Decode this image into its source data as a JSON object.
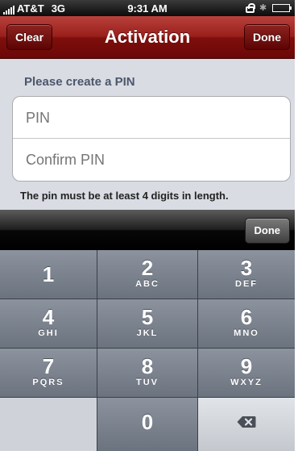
{
  "status_bar": {
    "carrier": "AT&T",
    "network": "3G",
    "time": "9:31 AM",
    "icons": [
      "signal-bars-icon",
      "lock-icon",
      "bluetooth-icon",
      "battery-icon"
    ]
  },
  "nav": {
    "title": "Activation",
    "left_button": "Clear",
    "right_button": "Done"
  },
  "form": {
    "section_header": "Please create a PIN",
    "pin_placeholder": "PIN",
    "confirm_placeholder": "Confirm PIN",
    "hint": "The pin must be at least 4 digits in length."
  },
  "accessory": {
    "done_label": "Done"
  },
  "keypad": {
    "keys": [
      {
        "digit": "1",
        "letters": ""
      },
      {
        "digit": "2",
        "letters": "ABC"
      },
      {
        "digit": "3",
        "letters": "DEF"
      },
      {
        "digit": "4",
        "letters": "GHI"
      },
      {
        "digit": "5",
        "letters": "JKL"
      },
      {
        "digit": "6",
        "letters": "MNO"
      },
      {
        "digit": "7",
        "letters": "PQRS"
      },
      {
        "digit": "8",
        "letters": "TUV"
      },
      {
        "digit": "9",
        "letters": "WXYZ"
      },
      {
        "digit": "0",
        "letters": ""
      }
    ],
    "delete_icon": "backspace-icon"
  },
  "colors": {
    "nav_bar": "#9a1f1b",
    "keypad_key": "#7b828d",
    "background": "#d9dce2"
  }
}
